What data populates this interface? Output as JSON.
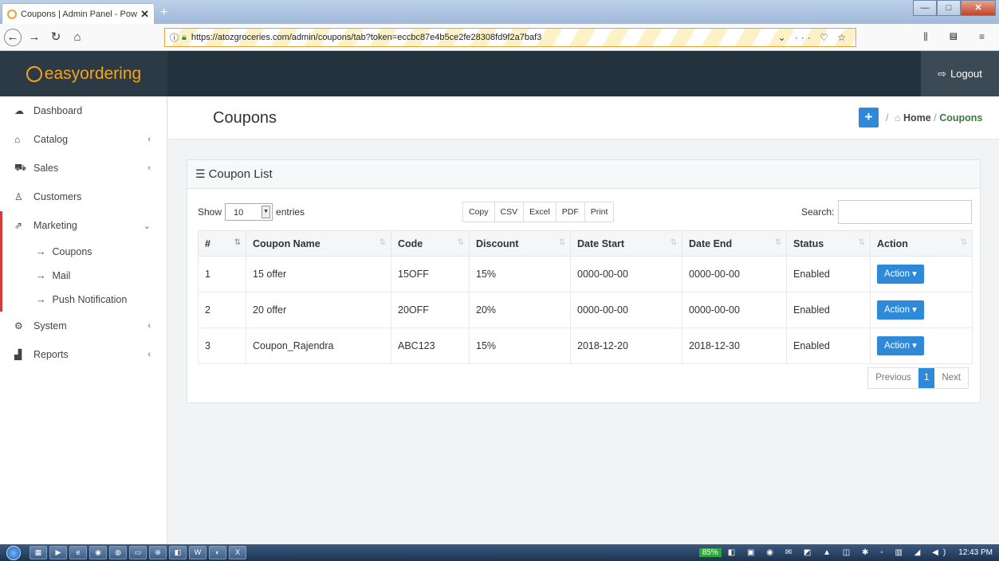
{
  "browser": {
    "tab_title": "Coupons | Admin Panel - Powe",
    "tab_close": "✕",
    "new_tab": "+",
    "url": "https://atozgroceries.com/admin/coupons/tab?token=eccbc87e4b5ce2fe28308fd9f2a7baf3",
    "win_min": "—",
    "win_max": "□",
    "win_close": "✕",
    "nav_icons": [
      "arrow-left-icon",
      "arrow-right-icon",
      "reload-icon",
      "home-icon"
    ],
    "url_icons": "⌄ ··· ♡ ☆",
    "right_icons": "⫼ ▤ ≡"
  },
  "header": {
    "brand": "easyordering",
    "logout_label": "Logout"
  },
  "sidebar": {
    "items": [
      {
        "label": "Dashboard",
        "icon": "dashboard-icon",
        "glyph": "☁",
        "chevron": ""
      },
      {
        "label": "Catalog",
        "icon": "tag-icon",
        "glyph": "⌂",
        "chevron": "‹"
      },
      {
        "label": "Sales",
        "icon": "cart-icon",
        "glyph": "⛟",
        "chevron": "‹"
      },
      {
        "label": "Customers",
        "icon": "user-icon",
        "glyph": "♙",
        "chevron": ""
      },
      {
        "label": "Marketing",
        "icon": "share-icon",
        "glyph": "⇗",
        "chevron": "⌄"
      },
      {
        "label": "System",
        "icon": "gear-icon",
        "glyph": "⚙",
        "chevron": "‹"
      },
      {
        "label": "Reports",
        "icon": "bar-chart-icon",
        "glyph": "▟",
        "chevron": "‹"
      }
    ],
    "marketing_sub": [
      {
        "label": "Coupons"
      },
      {
        "label": "Mail"
      },
      {
        "label": "Push Notification"
      }
    ]
  },
  "page": {
    "title": "Coupons",
    "add_label": "+",
    "breadcrumb": {
      "sep": "/",
      "home": "Home",
      "current": "Coupons"
    }
  },
  "panel": {
    "title": "Coupon List",
    "show_label": "Show",
    "entries_value": "10",
    "entries_label": "entries",
    "export_buttons": [
      "Copy",
      "CSV",
      "Excel",
      "PDF",
      "Print"
    ],
    "search_label": "Search:",
    "columns": [
      "#",
      "Coupon Name",
      "Code",
      "Discount",
      "Date Start",
      "Date End",
      "Status",
      "Action"
    ],
    "rows": [
      {
        "num": "1",
        "name": "15 offer",
        "code": "15OFF",
        "discount": "15%",
        "start": "0000-00-00",
        "end": "0000-00-00",
        "status": "Enabled",
        "action": "Action"
      },
      {
        "num": "2",
        "name": "20 offer",
        "code": "20OFF",
        "discount": "20%",
        "start": "0000-00-00",
        "end": "0000-00-00",
        "status": "Enabled",
        "action": "Action"
      },
      {
        "num": "3",
        "name": "Coupon_Rajendra",
        "code": "ABC123",
        "discount": "15%",
        "start": "2018-12-20",
        "end": "2018-12-30",
        "status": "Enabled",
        "action": "Action"
      }
    ],
    "pager": {
      "prev": "Previous",
      "page": "1",
      "next": "Next"
    }
  },
  "taskbar": {
    "battery": "85%",
    "clock": "12:43 PM",
    "apps": [
      "explorer",
      "media",
      "ie",
      "chrome",
      "firefox",
      "folder",
      "globe",
      "app",
      "word",
      "paint",
      "excel"
    ]
  },
  "colors": {
    "accent": "#2e8ad8",
    "brand": "#f2a51a",
    "header": "#24323d",
    "marketing_border": "#d33c3c"
  }
}
